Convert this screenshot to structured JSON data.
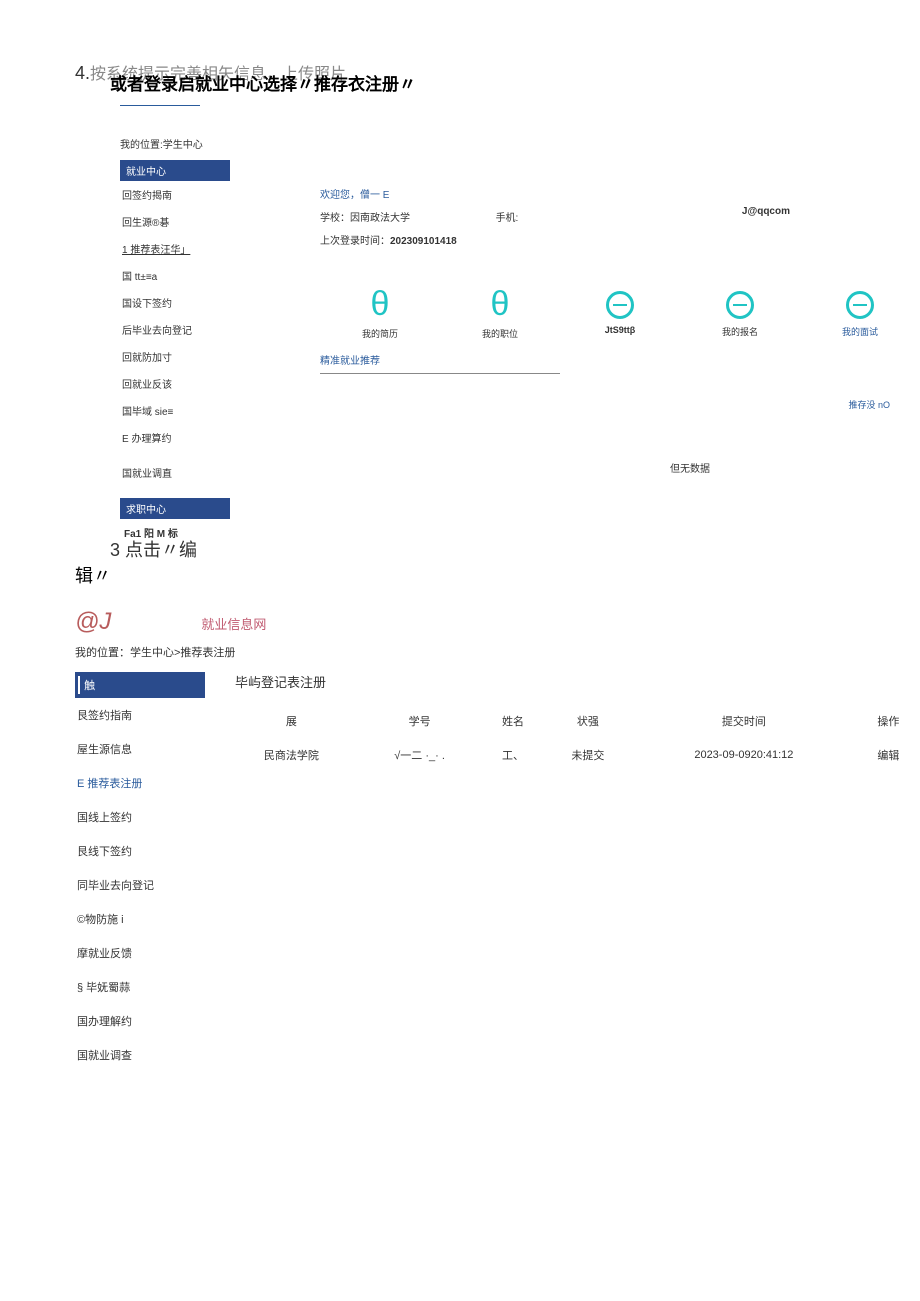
{
  "step4": {
    "num": "4.",
    "text": "按系统提示完善相矢信息，上传照片"
  },
  "step_title": "或者登录启就业中心选择〃推存衣注册〃",
  "section1": {
    "breadcrumb": "我的位置:学生中心",
    "sidebar": {
      "header": "就业中心",
      "items": [
        "回签约揭南",
        "回生源®碁",
        "1 推荐表汪华」",
        "国 tt±≡a",
        "国设下签约",
        "后毕业去向登记",
        "回就防加寸",
        "回就业反该",
        "国毕域 sie≡",
        "E 办理算约",
        "国就业调直"
      ],
      "header2": "求职中心",
      "fa": "Fa1 阳 M 标"
    },
    "welcome": "欢迎您，僧一 E",
    "school_label": "学校：",
    "school_value": "因南政法大学",
    "phone_label": "手机:",
    "login_label": "上次登录时间：",
    "login_value": "202309101418",
    "email": "J@qqcom",
    "icons": [
      {
        "label": "我的简历",
        "style": "open",
        "labelClass": ""
      },
      {
        "label": "我的职位",
        "style": "open",
        "labelClass": ""
      },
      {
        "label": "JtS9ttβ",
        "style": "circle",
        "labelClass": "bold"
      },
      {
        "label": "我的报名",
        "style": "circle",
        "labelClass": ""
      },
      {
        "label": "我的面试",
        "style": "circle",
        "labelClass": "blue"
      }
    ],
    "precise": "精准就业推荐",
    "more": "推存没 nO",
    "no_data": "但无数据"
  },
  "step3": {
    "line1": "3 点击〃编",
    "line2": "辑〃"
  },
  "section2": {
    "logo": "@J",
    "site": "就业信息网",
    "breadcrumb": "我的位置：学生中心>推荐表注册",
    "sidebar": {
      "header": "触",
      "items": [
        {
          "label": "艮签约指南",
          "class": ""
        },
        {
          "label": "屋生源信息",
          "class": ""
        },
        {
          "label": "E 推荐表注册",
          "class": "blue"
        },
        {
          "label": "国线上签约",
          "class": ""
        },
        {
          "label": "艮线下签约",
          "class": ""
        },
        {
          "label": "同毕业去向登记",
          "class": ""
        },
        {
          "label": "©物防施 i",
          "class": ""
        },
        {
          "label": "摩就业反馈",
          "class": ""
        },
        {
          "label": "§ 毕妩蜀蒜",
          "class": ""
        },
        {
          "label": "国办理解约",
          "class": ""
        },
        {
          "label": "国就业调查",
          "class": ""
        }
      ]
    },
    "tab": "毕屿登记表注册",
    "table": {
      "headers": [
        "展",
        "学号",
        "姓名",
        "状强",
        "提交时间",
        "操作"
      ],
      "row": [
        "民商法学院",
        "√一二 ·_· .",
        "工、",
        "未提交",
        "2023-09-0920:41:12",
        "编辑"
      ]
    }
  }
}
